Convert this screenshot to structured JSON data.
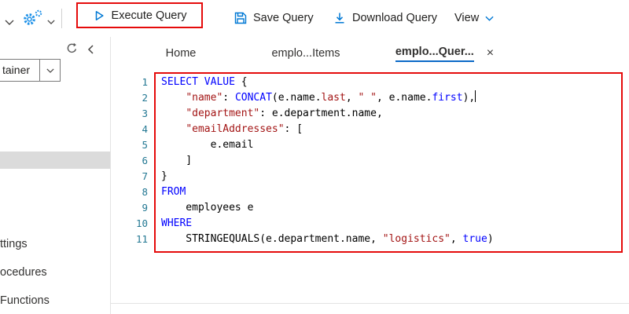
{
  "toolbar": {
    "execute_label": "Execute Query",
    "save_label": "Save Query",
    "download_label": "Download Query",
    "view_label": "View"
  },
  "sidebar": {
    "container_label": "tainer",
    "items": [
      {
        "label": "ttings"
      },
      {
        "label": "ocedures"
      },
      {
        "label": "Functions"
      }
    ]
  },
  "tabs": [
    {
      "label": "Home",
      "active": false,
      "closable": false
    },
    {
      "label": "emplo...Items",
      "active": false,
      "closable": false
    },
    {
      "label": "emplo...Quer...",
      "active": true,
      "closable": true
    }
  ],
  "ui": {
    "close_glyph": "×"
  },
  "colors": {
    "accent": "#0078d4",
    "keyword": "#0000ff",
    "string": "#a31515",
    "line_number": "#237893",
    "annotation": "#e50b0b"
  },
  "editor": {
    "lines": [
      {
        "num": 1,
        "tokens": [
          {
            "c": "kw",
            "t": "SELECT VALUE"
          },
          {
            "c": "pl",
            "t": " {"
          }
        ]
      },
      {
        "num": 2,
        "caret": true,
        "tokens": [
          {
            "c": "pl",
            "t": "    "
          },
          {
            "c": "str",
            "t": "\"name\""
          },
          {
            "c": "pl",
            "t": ": "
          },
          {
            "c": "kw",
            "t": "CONCAT"
          },
          {
            "c": "pl",
            "t": "(e.name."
          },
          {
            "c": "str",
            "t": "last"
          },
          {
            "c": "pl",
            "t": ", "
          },
          {
            "c": "str",
            "t": "\" \""
          },
          {
            "c": "pl",
            "t": ", e.name."
          },
          {
            "c": "kw",
            "t": "first"
          },
          {
            "c": "pl",
            "t": "),"
          }
        ]
      },
      {
        "num": 3,
        "tokens": [
          {
            "c": "pl",
            "t": "    "
          },
          {
            "c": "str",
            "t": "\"department\""
          },
          {
            "c": "pl",
            "t": ": e.department.name,"
          }
        ]
      },
      {
        "num": 4,
        "tokens": [
          {
            "c": "pl",
            "t": "    "
          },
          {
            "c": "str",
            "t": "\"emailAddresses\""
          },
          {
            "c": "pl",
            "t": ": ["
          }
        ]
      },
      {
        "num": 5,
        "tokens": [
          {
            "c": "pl",
            "t": "        e.email"
          }
        ]
      },
      {
        "num": 6,
        "tokens": [
          {
            "c": "pl",
            "t": "    ]"
          }
        ]
      },
      {
        "num": 7,
        "tokens": [
          {
            "c": "pl",
            "t": "}"
          }
        ]
      },
      {
        "num": 8,
        "tokens": [
          {
            "c": "kw",
            "t": "FROM"
          }
        ]
      },
      {
        "num": 9,
        "tokens": [
          {
            "c": "pl",
            "t": "    employees e"
          }
        ]
      },
      {
        "num": 10,
        "tokens": [
          {
            "c": "kw",
            "t": "WHERE"
          }
        ]
      },
      {
        "num": 11,
        "tokens": [
          {
            "c": "pl",
            "t": "    STRINGEQUALS(e.department.name, "
          },
          {
            "c": "str",
            "t": "\"logistics\""
          },
          {
            "c": "pl",
            "t": ", "
          },
          {
            "c": "kw",
            "t": "true"
          },
          {
            "c": "pl",
            "t": ")"
          }
        ]
      }
    ]
  }
}
